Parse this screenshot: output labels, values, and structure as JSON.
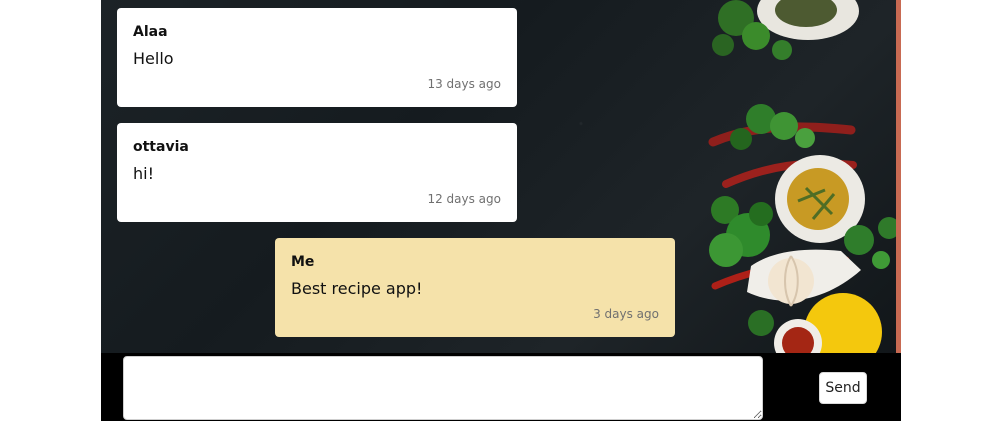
{
  "chat": {
    "messages": [
      {
        "author": "Alaa",
        "text": "Hello",
        "time": "13 days ago",
        "side": "other"
      },
      {
        "author": "ottavia",
        "text": "hi!",
        "time": "12 days ago",
        "side": "other"
      },
      {
        "author": "Me",
        "text": "Best recipe app!",
        "time": "3 days ago",
        "side": "me"
      }
    ]
  },
  "composer": {
    "message_value": "",
    "message_placeholder": "",
    "send_label": "Send"
  },
  "colors": {
    "other_message_bg": "#ffffff",
    "my_message_bg": "#f5e2aa",
    "composer_bg": "#000000",
    "accent_edge": "#c86a52"
  }
}
